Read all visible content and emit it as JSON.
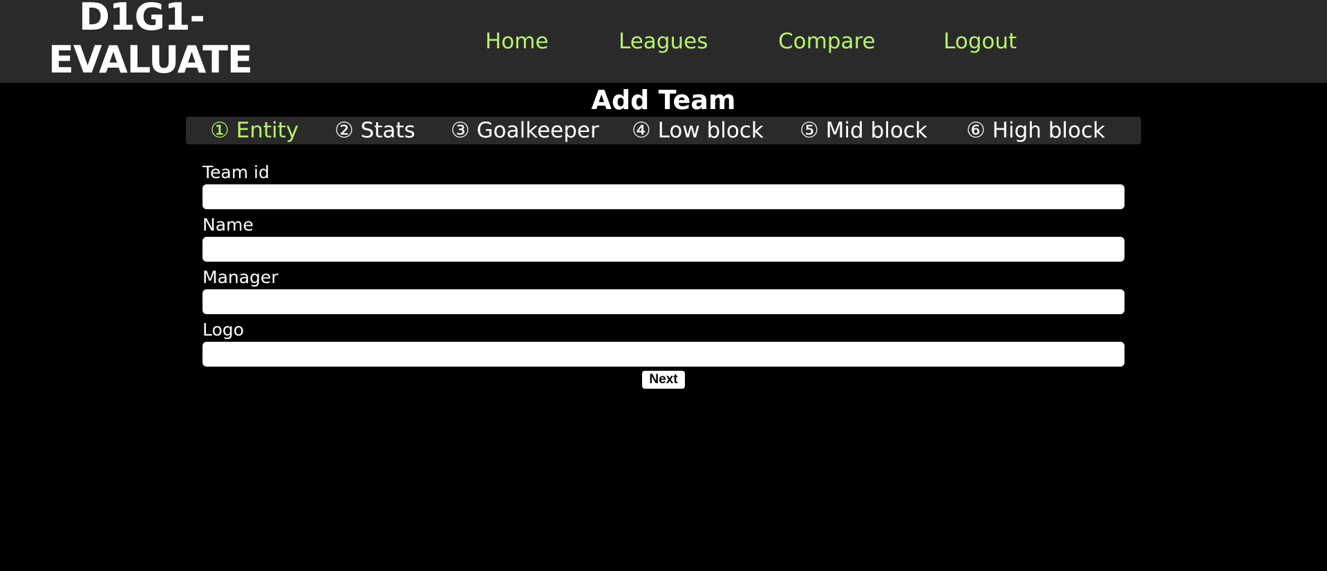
{
  "brand": {
    "line1": "D1G1-",
    "line2": "EVALUATE"
  },
  "nav": {
    "items": [
      {
        "label": "Home"
      },
      {
        "label": "Leagues"
      },
      {
        "label": "Compare"
      },
      {
        "label": "Logout"
      }
    ]
  },
  "page": {
    "title": "Add Team"
  },
  "steps": [
    {
      "label": "① Entity",
      "active": true
    },
    {
      "label": "② Stats",
      "active": false
    },
    {
      "label": "③ Goalkeeper",
      "active": false
    },
    {
      "label": "④ Low block",
      "active": false
    },
    {
      "label": "⑤ Mid block",
      "active": false
    },
    {
      "label": "⑥ High block",
      "active": false
    }
  ],
  "form": {
    "fields": [
      {
        "label": "Team id",
        "value": ""
      },
      {
        "label": "Name",
        "value": ""
      },
      {
        "label": "Manager",
        "value": ""
      },
      {
        "label": "Logo",
        "value": ""
      }
    ],
    "next_label": "Next"
  },
  "colors": {
    "accent": "#b7f36a",
    "header_bg": "#2a2a2a",
    "page_bg": "#000000"
  }
}
